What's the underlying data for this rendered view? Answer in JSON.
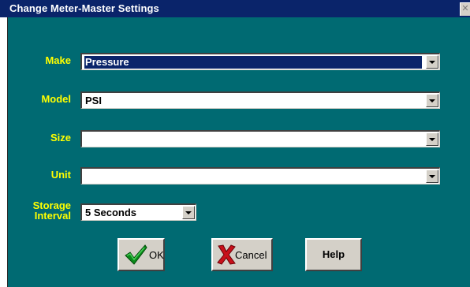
{
  "window": {
    "title": "Change Meter-Master Settings",
    "close_glyph": "✕"
  },
  "form": {
    "make": {
      "label": "Make",
      "value": "Pressure"
    },
    "model": {
      "label": "Model",
      "value": "PSI"
    },
    "size": {
      "label": "Size",
      "value": ""
    },
    "unit": {
      "label": "Unit",
      "value": ""
    },
    "storage_interval": {
      "label_line1": "Storage",
      "label_line2": "Interval",
      "value": "5 Seconds"
    }
  },
  "buttons": {
    "ok": {
      "label": "OK",
      "icon": "checkmark-icon"
    },
    "cancel": {
      "label": "Cancel",
      "icon": "red-x-icon"
    },
    "help": {
      "label": "Help"
    }
  },
  "colors": {
    "titlebar": "#0a246a",
    "client_background": "#006a72",
    "label_text": "#ffff00",
    "selection": "#0a246a",
    "button_face": "#d4d0c8"
  }
}
